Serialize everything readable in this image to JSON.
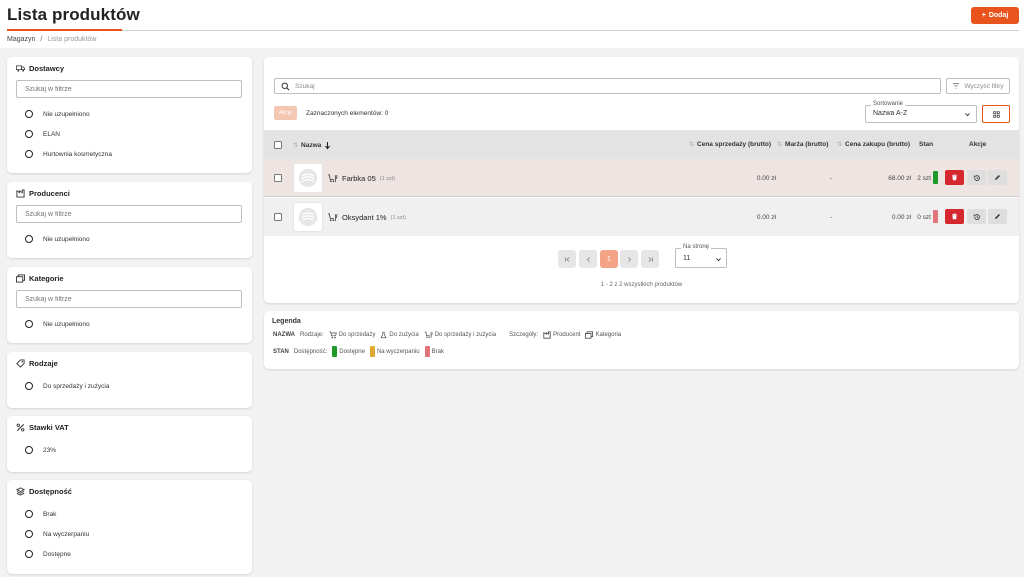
{
  "header": {
    "title": "Lista produktów",
    "add_label": "Dodaj",
    "breadcrumb": [
      "Magazyn",
      "Lista produktów"
    ]
  },
  "filters": {
    "suppliers": {
      "title": "Dostawcy",
      "placeholder": "Szukaj w filtrze",
      "options": [
        "Nie uzupełniono",
        "ELAN",
        "Hurtownia kosmetyczna"
      ]
    },
    "producers": {
      "title": "Producenci",
      "placeholder": "Szukaj w filtrze",
      "options": [
        "Nie uzupełniono"
      ]
    },
    "categories": {
      "title": "Kategorie",
      "placeholder": "Szukaj w filtrze",
      "options": [
        "Nie uzupełniono"
      ]
    },
    "kinds": {
      "title": "Rodzaje",
      "options": [
        "Do sprzedaży i zużycia"
      ]
    },
    "vat": {
      "title": "Stawki VAT",
      "options": [
        "23%"
      ]
    },
    "availability": {
      "title": "Dostępność",
      "options": [
        "Brak",
        "Na wyczerpaniu",
        "Dostępne"
      ]
    }
  },
  "toolbar": {
    "search_placeholder": "Szukaj",
    "clear_label": "Wyczyść filtry",
    "actions_label": "Akcje",
    "selected_label": "Zaznaczonych elementów: 0",
    "sort_label": "Sortowanie",
    "sort_value": "Nazwa A-Z"
  },
  "table": {
    "columns": {
      "name": "Nazwa",
      "sale_price": "Cena sprzedaży (brutto)",
      "margin": "Marża (brutto)",
      "purchase_price": "Cena zakupu (brutto)",
      "stock": "Stan",
      "actions": "Akcje"
    },
    "rows": [
      {
        "name": "Farbka 05",
        "qty": "(1 szt)",
        "sale_price": "0.00 zł",
        "margin": "-",
        "purchase_price": "68.00 zł",
        "stock": "2 szt"
      },
      {
        "name": "Oksydant 1%",
        "qty": "(1 szt)",
        "sale_price": "0.00 zł",
        "margin": "-",
        "purchase_price": "0.00 zł",
        "stock": "0 szt"
      }
    ]
  },
  "pagination": {
    "current_page": "1",
    "per_page_label": "Na stronę",
    "per_page_value": "11",
    "summary": "1 - 2 z 2 wszystkich produktów"
  },
  "legend": {
    "title": "Legenda",
    "name_key": "NAZWA",
    "kinds_label": "Rodzaje:",
    "kinds": [
      "Do sprzedaży",
      "Do zużycia",
      "Do sprzedaży i zużycia"
    ],
    "details_label": "Szczegóły:",
    "details": [
      "Producent",
      "Kategoria"
    ],
    "stock_key": "STAN",
    "availability_label": "Dostępność:",
    "availability": [
      "Dostępne",
      "Na wyczerpaniu",
      "Brak"
    ]
  },
  "colors": {
    "accent": "#e8541c",
    "available": "#1e9a2c",
    "low": "#e0a82e",
    "none": "#e3737a",
    "delete": "#d4272e"
  }
}
